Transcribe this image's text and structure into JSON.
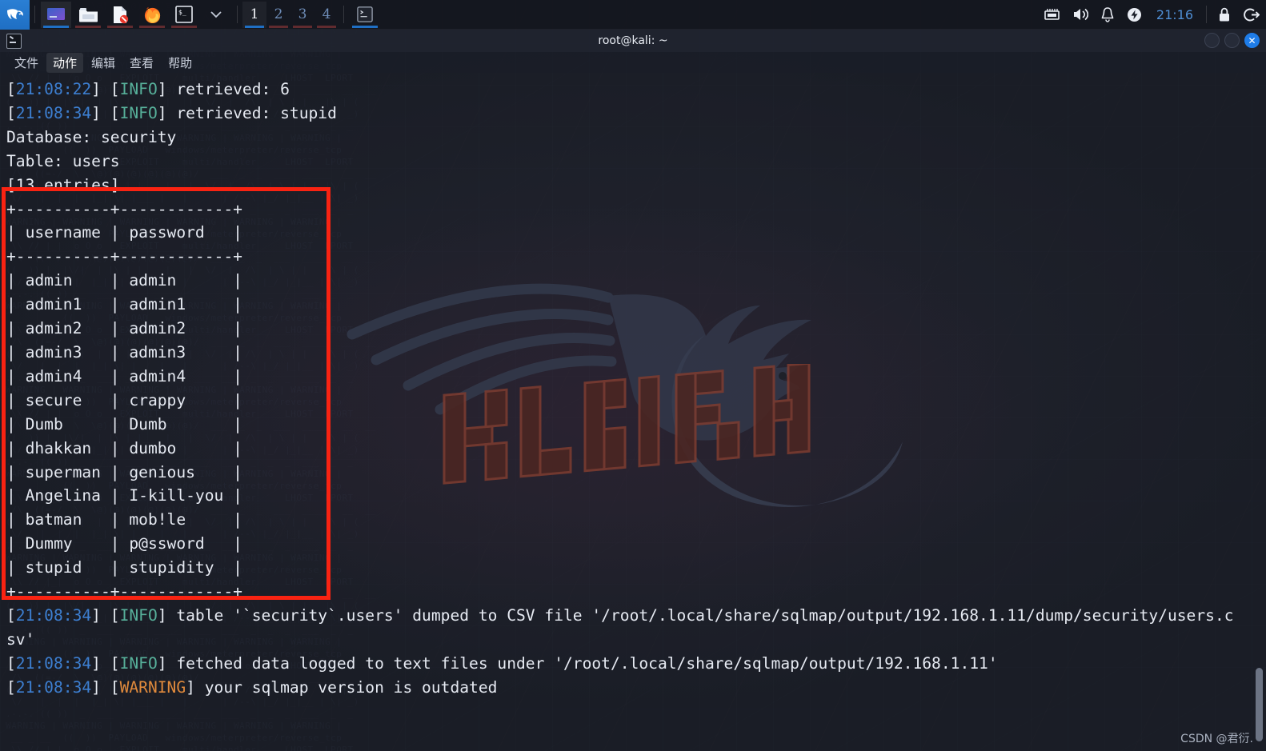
{
  "panel": {
    "launcher_icon": "kali-dragon-logo",
    "tasks": [
      {
        "name": "window-switcher",
        "icon": "display-window-icon",
        "active": true
      },
      {
        "name": "file-manager",
        "icon": "folder-icon",
        "active": false
      },
      {
        "name": "text-editor",
        "icon": "document-forbidden-icon",
        "active": false
      },
      {
        "name": "firefox",
        "icon": "firefox-icon",
        "active": false
      },
      {
        "name": "terminal",
        "icon": "terminal-icon",
        "active": false
      },
      {
        "name": "show-more",
        "icon": "chevron-down-icon",
        "active": false
      }
    ],
    "workspaces": [
      {
        "label": "1",
        "active": true
      },
      {
        "label": "2",
        "active": false
      },
      {
        "label": "3",
        "active": false
      },
      {
        "label": "4",
        "active": false
      }
    ],
    "taskbar_window": {
      "icon": "terminal-icon",
      "label": ""
    },
    "tray": [
      {
        "name": "network-icon",
        "glyph": "network"
      },
      {
        "name": "volume-icon",
        "glyph": "volume"
      },
      {
        "name": "notifications-icon",
        "glyph": "bell"
      },
      {
        "name": "power-manager-icon",
        "glyph": "battery-bolt"
      }
    ],
    "clock": "21:16",
    "lock_icon": "lock-icon",
    "logout_icon": "logout-icon",
    "accent": "#1f6fc4",
    "clock_color": "#4f8fd6"
  },
  "terminal": {
    "title": "root@kali: ~",
    "tab_icon": "terminal-icon",
    "window_buttons": {
      "minimize": "minimize-button",
      "maximize": "maximize-button",
      "close": "✕"
    },
    "menus": [
      {
        "label": "文件",
        "hover": false
      },
      {
        "label": "动作",
        "hover": true
      },
      {
        "label": "编辑",
        "hover": false
      },
      {
        "label": "查看",
        "hover": false
      },
      {
        "label": "帮助",
        "hover": false
      }
    ],
    "log_top": [
      {
        "ts": "21:08:22",
        "level": "INFO",
        "level_color": "#57b09a",
        "text": "retrieved: 6"
      },
      {
        "ts": "21:08:34",
        "level": "INFO",
        "level_color": "#57b09a",
        "text": "retrieved: stupid"
      }
    ],
    "meta_lines": [
      "Database: security",
      "Table: users",
      "[13 entries]"
    ],
    "dump_table": {
      "border": "+-----------+-------------+",
      "columns": [
        "username",
        "password"
      ],
      "rows": [
        [
          "admin",
          "admin"
        ],
        [
          "admin1",
          "admin1"
        ],
        [
          "admin2",
          "admin2"
        ],
        [
          "admin3",
          "admin3"
        ],
        [
          "admin4",
          "admin4"
        ],
        [
          "secure",
          "crappy"
        ],
        [
          "Dumb",
          "Dumb"
        ],
        [
          "dhakkan",
          "dumbo"
        ],
        [
          "superman",
          "genious"
        ],
        [
          "Angelina",
          "I-kill-you"
        ],
        [
          "batman",
          "mob!le"
        ],
        [
          "Dummy",
          "p@ssword"
        ],
        [
          "stupid",
          "stupidity"
        ]
      ]
    },
    "log_bottom": [
      {
        "ts": "21:08:34",
        "level": "INFO",
        "level_color": "#57b09a",
        "text": "table '`security`.users' dumped to CSV file '/root/.local/share/sqlmap/output/192.168.1.11/dump/security/users.csv'"
      },
      {
        "ts": "21:08:34",
        "level": "INFO",
        "level_color": "#57b09a",
        "text": "fetched data logged to text files under '/root/.local/share/sqlmap/output/192.168.1.11'"
      },
      {
        "ts": "21:08:34",
        "level": "WARNING",
        "level_color": "#e08a3c",
        "text": "your sqlmap version is outdated"
      }
    ],
    "annotation": {
      "name": "red-highlight-box",
      "color": "#f92312"
    },
    "scrollbar": {
      "name": "terminal-scrollbar"
    }
  },
  "wallpaper": {
    "logo_text": "KALI LINUX",
    "glyph_filler": "  /\\  ((=-/  \\  \\@)(@)(@)(@)(@)(@)/  ___  _  _  ___  _____  __  __ \n ((  )) |  |\\/|  | |\\ | |__  |   |  \\/  |  /\\  | \\ | |   |\\ | (  \n  \\/   |  |  |  |_| \\| |___ |   |      | /--\\ |_/ |_|__ | \\| _) \n .-.-. (( ))  _  ___  ___  _____  ___  ___  _  _  _  ___  _  _ \n WARNING | WARNING | WARNING | WARNING | WARNING | WARNING | \n  __ _ __  ((  ))  PAYLOAD   windows/meterpreter/reverse_tcp  \n  \\\\ // |_|  o O o   EXPLOIT    multi/handler     LHOST  LPORT \n"
  },
  "watermark": "CSDN @君衍."
}
